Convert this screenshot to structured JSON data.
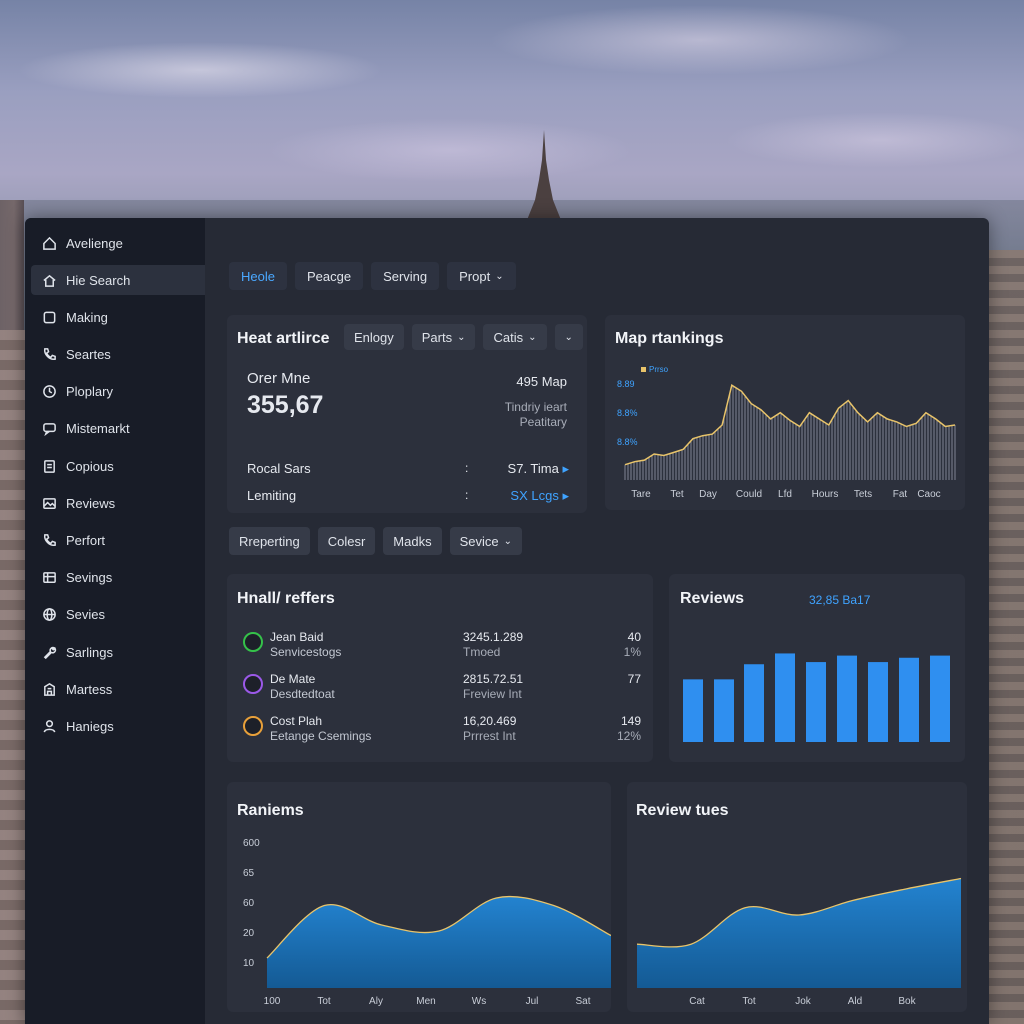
{
  "sidebar": {
    "items": [
      {
        "label": "Avelienge",
        "icon": "home-icon"
      },
      {
        "label": "Hie Search",
        "icon": "house-icon",
        "active": true
      },
      {
        "label": "Making",
        "icon": "square-icon"
      },
      {
        "label": "Seartes",
        "icon": "phone-icon"
      },
      {
        "label": "Ploplary",
        "icon": "clock-icon"
      },
      {
        "label": "Mistemarkt",
        "icon": "chat-icon"
      },
      {
        "label": "Copious",
        "icon": "document-icon"
      },
      {
        "label": "Reviews",
        "icon": "gallery-icon"
      },
      {
        "label": "Perfort",
        "icon": "phone-call-icon"
      },
      {
        "label": "Sevings",
        "icon": "grid-icon"
      },
      {
        "label": "Sevies",
        "icon": "globe-icon"
      },
      {
        "label": "Sarlings",
        "icon": "wrench-icon"
      },
      {
        "label": "Martess",
        "icon": "building-icon"
      },
      {
        "label": "Haniegs",
        "icon": "user-icon"
      }
    ]
  },
  "top_tabs": [
    {
      "label": "Heole",
      "active": true
    },
    {
      "label": "Peacge"
    },
    {
      "label": "Serving"
    },
    {
      "label": "Propt",
      "dropdown": true
    }
  ],
  "heat_card": {
    "title": "Heat artlirce",
    "chips": [
      {
        "label": "Enlogy"
      },
      {
        "label": "Parts",
        "dropdown": true
      },
      {
        "label": "Catis",
        "dropdown": true
      },
      {
        "label": "",
        "dropdown": true
      }
    ],
    "metric_label": "Orer Mne",
    "metric_value": "355,67",
    "right_value": "495 Map",
    "right_sub1": "Tindriy ieart",
    "right_sub2": "Peatitary",
    "rows": [
      {
        "label": "Rocal Sars",
        "sep": ":",
        "value": "S7. Tima",
        "arrow": "▸"
      },
      {
        "label": "Lemiting",
        "sep": ":",
        "value": "SX Lcgs",
        "arrow": "▸"
      }
    ]
  },
  "map_card": {
    "title": "Map rtankings",
    "legend": "Prrso",
    "y_ticks": [
      "8.89",
      "8.8%",
      "8.8%"
    ],
    "x_ticks": [
      "Tare",
      "Tet",
      "Day",
      "Could",
      "Lfd",
      "Hours",
      "Tets",
      "Fat",
      "Caoc"
    ]
  },
  "filter_chips": [
    {
      "label": "Rreperting"
    },
    {
      "label": "Colesr"
    },
    {
      "label": "Madks"
    },
    {
      "label": "Sevice",
      "dropdown": true
    }
  ],
  "hnall_card": {
    "title": "Hnall/ reffers",
    "rows": [
      {
        "name": "Jean Baid",
        "sub": "Senvicestogs",
        "v1": "3245.1.289",
        "v1sub": "Tmoed",
        "v2": "40",
        "v2sub": "1%",
        "color": "#35c24a"
      },
      {
        "name": "De Mate",
        "sub": "Desdtedtoat",
        "v1": "2815.72.51",
        "v1sub": "Freview Int",
        "v2": "77",
        "v2sub": "",
        "color": "#9b59e8"
      },
      {
        "name": "Cost Plah",
        "sub": "Eetange Csemings",
        "v1": "16,20.469",
        "v1sub": "Prrrest Int",
        "v2": "149",
        "v2sub": "12%",
        "color": "#e8a03a"
      }
    ]
  },
  "reviews_bar_card": {
    "title": "Reviews",
    "value": "32,85 Ba17"
  },
  "reviems_area_card": {
    "title": "Raniems",
    "y_ticks": [
      "600",
      "65",
      "60",
      "20",
      "10"
    ],
    "x_ticks": [
      "100",
      "Tot",
      "Aly",
      "Men",
      "Ws",
      "Jul",
      "Sat"
    ]
  },
  "review_tues_card": {
    "title": "Review tues",
    "x_ticks": [
      "Cat",
      "Tot",
      "Jok",
      "Ald",
      "Bok"
    ]
  },
  "colors": {
    "accent": "#3fa3ff",
    "bar": "#2f8ff0",
    "area_fill": "#1c72b8",
    "line_yellow": "#e9c46a",
    "card_bg": "#2c303c",
    "sidebar_bg": "#181c27"
  },
  "chart_data": [
    {
      "type": "area",
      "title": "Map rtankings",
      "y_tick_labels": [
        "8.89",
        "8.8%",
        "8.8%"
      ],
      "x_tick_labels": [
        "Tare",
        "Tet",
        "Day",
        "Could",
        "Lfd",
        "Hours",
        "Tets",
        "Fat",
        "Caoc"
      ],
      "series": [
        {
          "name": "Prrso",
          "values": [
            10,
            12,
            13,
            17,
            16,
            18,
            20,
            27,
            29,
            30,
            36,
            62,
            58,
            50,
            46,
            40,
            44,
            39,
            35,
            44,
            40,
            36,
            47,
            52,
            44,
            38,
            44,
            40,
            38,
            35,
            37,
            44,
            40,
            35,
            36
          ]
        }
      ],
      "ylim": [
        0,
        70
      ]
    },
    {
      "type": "bar",
      "title": "Reviews",
      "values": [
        58,
        58,
        72,
        82,
        74,
        80,
        74,
        78,
        80
      ],
      "ylim": [
        0,
        100
      ]
    },
    {
      "type": "area",
      "title": "Raniems",
      "y_tick_labels": [
        "600",
        "65",
        "60",
        "20",
        "10"
      ],
      "x_tick_labels": [
        "100",
        "Tot",
        "Aly",
        "Men",
        "Ws",
        "Jul",
        "Sat"
      ],
      "series": [
        {
          "values": [
            20,
            55,
            42,
            38,
            60,
            55,
            35
          ]
        }
      ],
      "ylim": [
        0,
        80
      ]
    },
    {
      "type": "area",
      "title": "Review tues",
      "x_tick_labels": [
        "Cat",
        "Tot",
        "Jok",
        "Ald",
        "Bok"
      ],
      "series": [
        {
          "values": [
            30,
            30,
            55,
            50,
            60,
            68,
            75
          ]
        }
      ],
      "ylim": [
        0,
        100
      ]
    }
  ]
}
